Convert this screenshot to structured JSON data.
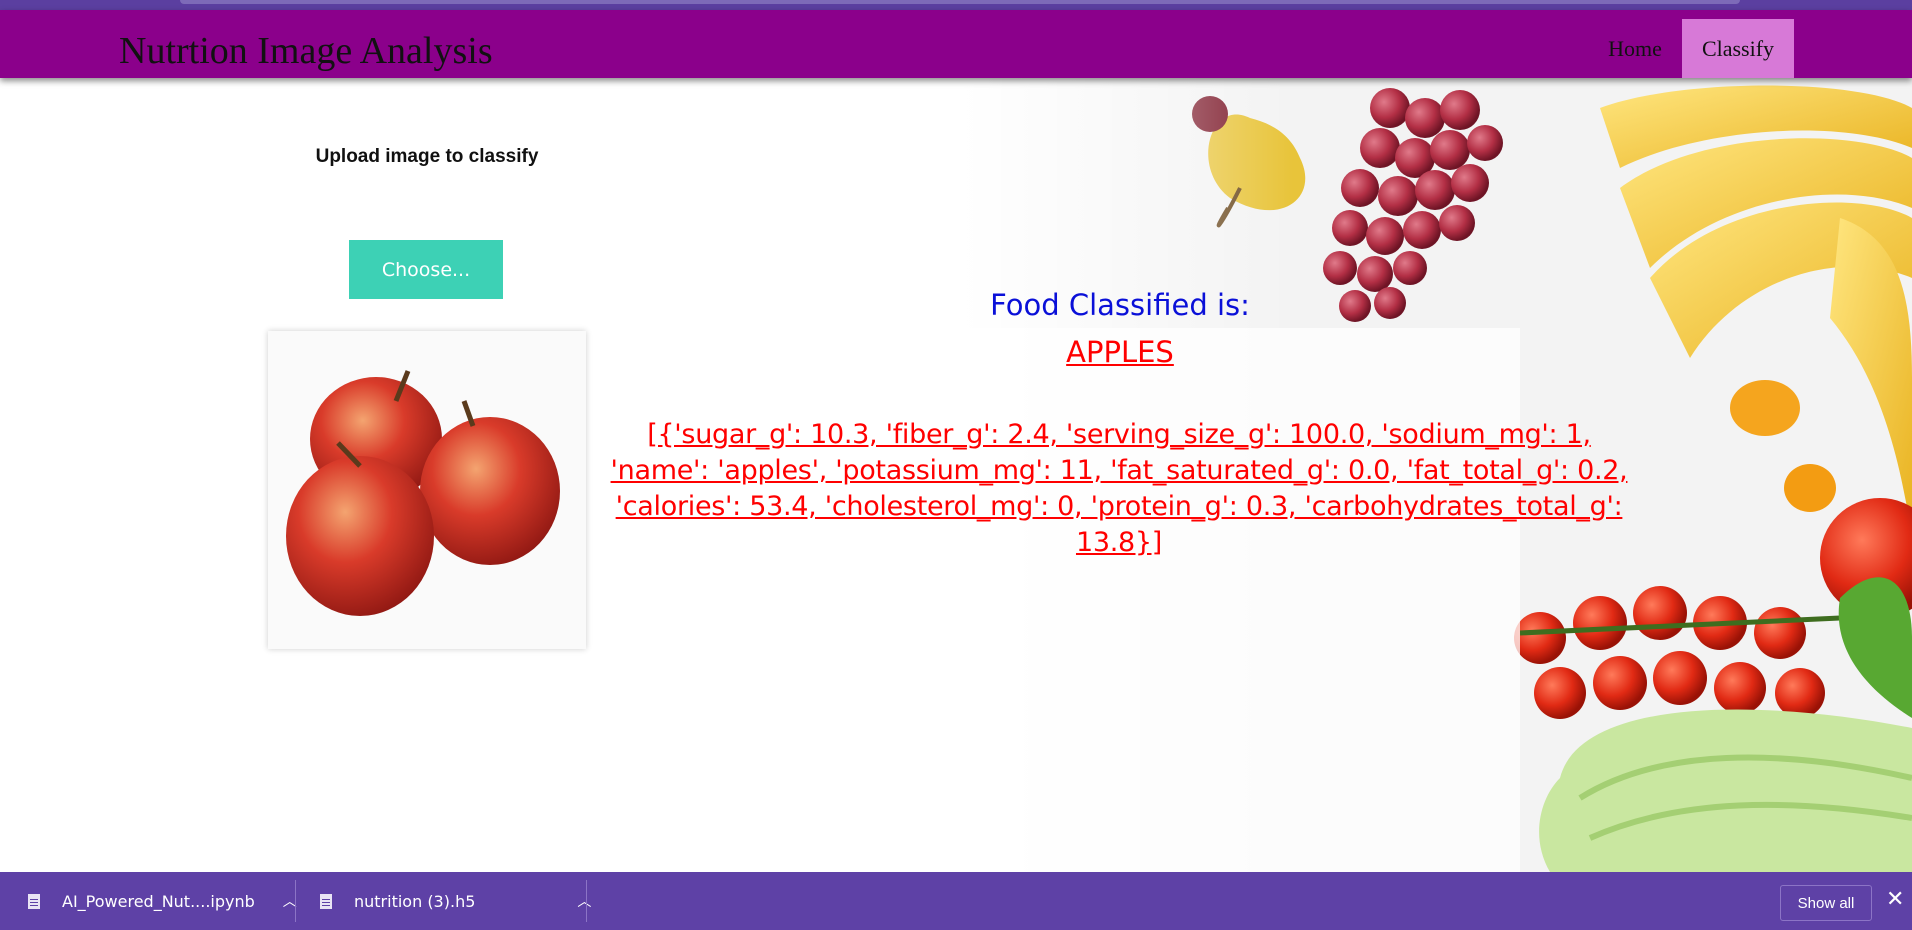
{
  "navbar": {
    "brand": "Nutrtion Image Analysis",
    "links": [
      {
        "label": "Home",
        "active": false
      },
      {
        "label": "Classify",
        "active": true
      }
    ],
    "bg_color": "#8b008b",
    "active_color": "#d779d7"
  },
  "upload": {
    "title": "Upload image to classify",
    "choose_label": "Choose...",
    "button_color": "#3dd1b5",
    "preview_image": "red-apples-photo"
  },
  "result": {
    "label": "Food Classified is:",
    "value": "APPLES",
    "nutrition_text": "[{'sugar_g': 10.3, 'fiber_g': 2.4, 'serving_size_g': 100.0, 'sodium_mg': 1, 'name': 'apples', 'potassium_mg': 11, 'fat_saturated_g': 0.0, 'fat_total_g': 0.2, 'calories': 53.4, 'cholesterol_mg': 0, 'protein_g': 0.3, 'carbohydrates_total_g': 13.8}]",
    "label_color": "#0a10d8",
    "value_color": "#ff0000"
  },
  "downloads": {
    "items": [
      {
        "filename": "AI_Powered_Nut....ipynb",
        "icon": "file-icon"
      },
      {
        "filename": "nutrition (3).h5",
        "icon": "file-icon"
      }
    ],
    "show_all_label": "Show all",
    "close_label": "✕",
    "bg_color": "#5e41a6"
  }
}
